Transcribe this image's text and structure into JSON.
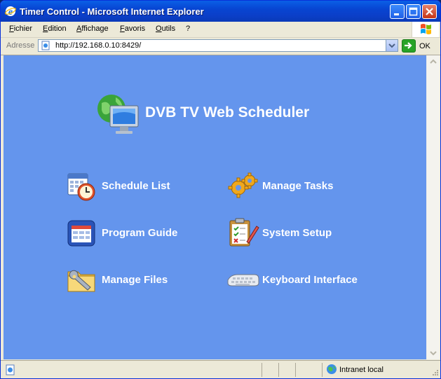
{
  "window": {
    "title": "Timer Control - Microsoft Internet Explorer"
  },
  "menu": {
    "items": [
      "Fichier",
      "Edition",
      "Affichage",
      "Favoris",
      "Outils",
      "?"
    ]
  },
  "address": {
    "label": "Adresse",
    "url": "http://192.168.0.10:8429/",
    "go_label": "OK"
  },
  "page": {
    "heading": "DVB TV Web Scheduler",
    "links": [
      {
        "label": "Schedule List"
      },
      {
        "label": "Manage Tasks"
      },
      {
        "label": "Program Guide"
      },
      {
        "label": "System Setup"
      },
      {
        "label": "Manage Files"
      },
      {
        "label": "Keyboard Interface"
      }
    ]
  },
  "status": {
    "zone": "Intranet local"
  },
  "colors": {
    "page_background": "#6495ed",
    "titlebar": "#0845d2",
    "link_text": "#ffffff"
  },
  "icons": {
    "hero": "globe-monitor-icon",
    "links": [
      "calendar-clock-icon",
      "gears-icon",
      "program-guide-icon",
      "clipboard-checklist-icon",
      "folder-wrench-icon",
      "keyboard-icon"
    ]
  }
}
